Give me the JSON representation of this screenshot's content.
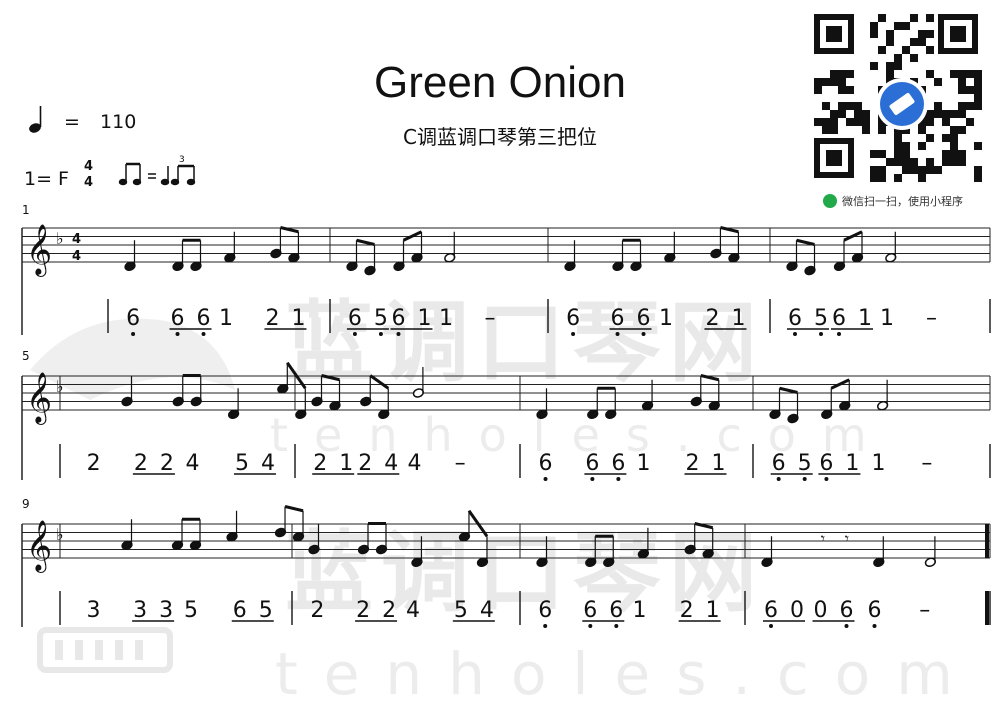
{
  "title": "Green Onion",
  "subtitle": "C调蓝调口琴第三把位",
  "tempo": {
    "equals": "=",
    "bpm": "110"
  },
  "key": {
    "label": "1= F",
    "time_top": "4",
    "time_bottom": "4"
  },
  "qr_caption": "微信扫一扫，使用小程序",
  "watermark": {
    "brand_cn": "蓝调口琴网",
    "brand_en": "tenholes.com"
  },
  "measure_numbers": [
    "1",
    "5",
    "9"
  ],
  "systems": [
    {
      "number": "1",
      "jianpu": "| 6 66 1 21 | 65 61 1 – | 6 66 1 21 | 65 61 1 –"
    },
    {
      "number": "5",
      "jianpu": "2 22 4 54 | 21 24 4 – | 6 66 1 21 | 65 61 1 –"
    },
    {
      "number": "9",
      "jianpu": "3 33 5 65 | 2 22 4 54 | 6 66 1 21 | 60 06 6 –"
    }
  ],
  "icons": {
    "tempo_note": "quarter-note-icon",
    "swing": "swing-rhythm-icon",
    "miniprogram": "miniprogram-icon"
  }
}
